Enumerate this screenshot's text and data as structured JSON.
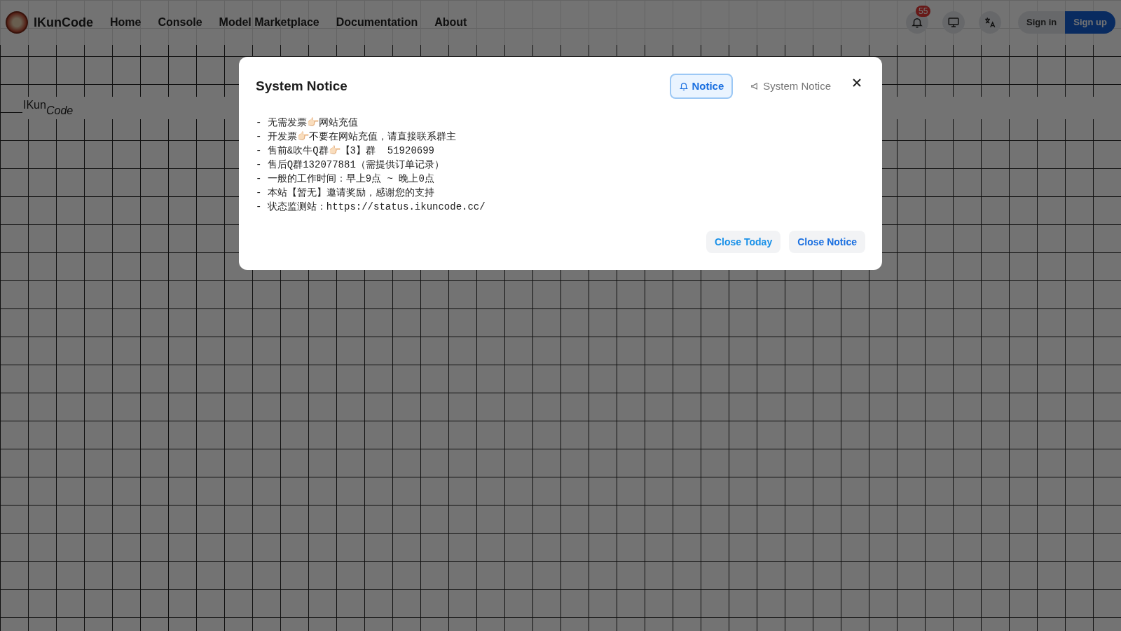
{
  "header": {
    "brand": "IKunCode",
    "nav": [
      "Home",
      "Console",
      "Model Marketplace",
      "Documentation",
      "About"
    ],
    "notification_count": "55",
    "buttons": [
      {
        "label": "Sign in",
        "kind": "plain"
      },
      {
        "label": "Sign up",
        "kind": "primary"
      }
    ]
  },
  "background_logo": {
    "first": "IKun",
    "second": "Code"
  },
  "dialog": {
    "title": "System Notice",
    "tabs": [
      {
        "label": "Notice",
        "kind": "bell",
        "selected": true
      },
      {
        "label": "System Notice",
        "kind": "megaphone",
        "selected": false
      }
    ],
    "lines": [
      "- 无需发票👉🏻网站充值",
      "- 开发票👉🏻不要在网站充值，请直接联系群主",
      "- 售前&吹牛Q群👉🏻【3】群  51920699",
      "- 售后Q群132077881（需提供订单记录）",
      "- 一般的工作时间：早上9点 ~ 晚上0点",
      "- 本站【暂无】邀请奖励，感谢您的支持",
      "- 状态监测站：https://status.ikuncode.cc/"
    ],
    "buttons": [
      "Close Today",
      "Close Notice"
    ]
  }
}
